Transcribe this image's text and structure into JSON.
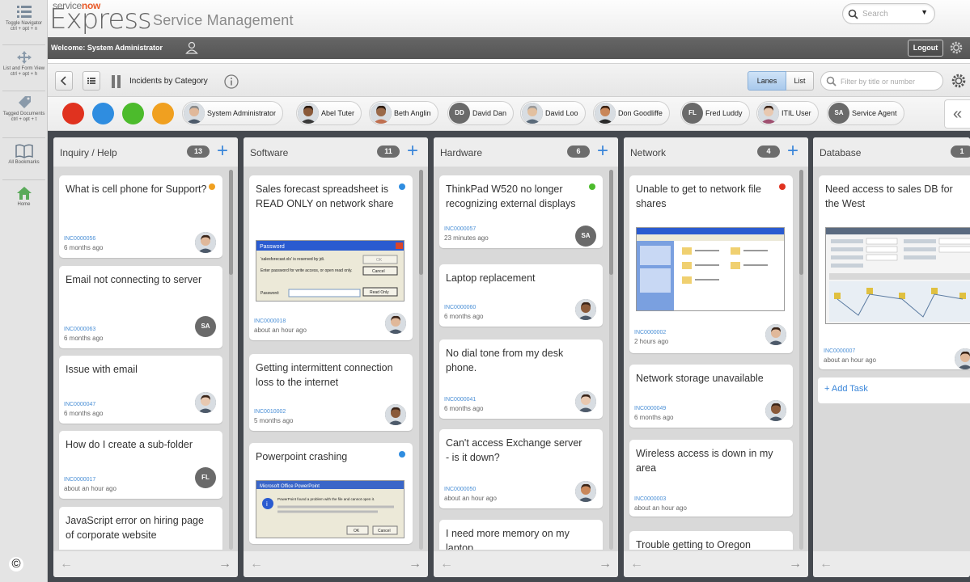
{
  "brand": {
    "top_prefix": "service",
    "top_accent": "now",
    "product": "Express",
    "subtitle": "Service Management"
  },
  "search": {
    "placeholder": "Search"
  },
  "nav": [
    {
      "label": "Toggle Navigator",
      "shortcut": "ctrl + opt + n",
      "icon": "menu-icon"
    },
    {
      "label": "List and Form View",
      "shortcut": "ctrl + opt + h",
      "icon": "arrows-icon"
    },
    {
      "label": "Tagged Documents",
      "shortcut": "ctrl + opt + t",
      "icon": "tag-icon"
    },
    {
      "label": "All Bookmarks",
      "shortcut": "",
      "icon": "book-icon"
    },
    {
      "label": "Home",
      "shortcut": "",
      "icon": "home-icon"
    }
  ],
  "user_bar": {
    "welcome": "Welcome: System Administrator",
    "logout": "Logout"
  },
  "toolbar": {
    "title": "Incidents by Category",
    "lanes": "Lanes",
    "list": "List",
    "filter_placeholder": "Filter by title or number"
  },
  "members": [
    {
      "name": "System Administrator",
      "avatar": "photo"
    },
    {
      "name": "Abel Tuter",
      "avatar": "photo"
    },
    {
      "name": "Beth Anglin",
      "avatar": "photo"
    },
    {
      "name": "David Dan",
      "avatar": "DD"
    },
    {
      "name": "David Loo",
      "avatar": "photo"
    },
    {
      "name": "Don Goodliffe",
      "avatar": "photo"
    },
    {
      "name": "Fred Luddy",
      "avatar": "FL"
    },
    {
      "name": "ITIL User",
      "avatar": "photo"
    },
    {
      "name": "Service Agent",
      "avatar": "SA"
    }
  ],
  "color_filters": [
    "#e0321f",
    "#2f8de0",
    "#4cbb2c",
    "#f0a020"
  ],
  "lanes": [
    {
      "title": "Inquiry / Help",
      "count": "13",
      "cards": [
        {
          "title": "What is cell phone for Support?",
          "number": "INC0000056",
          "age": "6 months ago",
          "dot": "#f0a020",
          "avatar": "photo"
        },
        {
          "title": "Email not connecting to server",
          "number": "INC0000063",
          "age": "6 months ago",
          "dot": "",
          "avatar": "SA"
        },
        {
          "title": "Issue with email",
          "number": "INC0000047",
          "age": "6 months ago",
          "dot": "",
          "avatar": "photo"
        },
        {
          "title": "How do I create a sub-folder",
          "number": "INC0000017",
          "age": "about an hour ago",
          "dot": "",
          "avatar": "FL"
        },
        {
          "title": "JavaScript error on hiring page of corporate website",
          "number": "",
          "age": "",
          "dot": "",
          "avatar": ""
        }
      ]
    },
    {
      "title": "Software",
      "count": "11",
      "cards": [
        {
          "title": "Sales forecast spreadsheet is READ ONLY on network share",
          "number": "INC0000018",
          "age": "about an hour ago",
          "dot": "#2f8de0",
          "avatar": "photo",
          "screenshot": {
            "title": "Password",
            "text": "'salesforecast.xls' is reserved by jdi. Enter password for write access, or open read only.",
            "field": "Password:",
            "buttons": [
              "OK",
              "Cancel",
              "Read Only"
            ]
          }
        },
        {
          "title": "Getting intermittent connection loss to the internet",
          "number": "INC0010002",
          "age": "5 months ago",
          "dot": "",
          "avatar": "photo"
        },
        {
          "title": "Powerpoint crashing",
          "number": "",
          "age": "",
          "dot": "#2f8de0",
          "avatar": "",
          "screenshot": {
            "title": "Microsoft Office PowerPoint",
            "text": "PowerPoint found a problem with the file and cannot open it.",
            "buttons": [
              "OK",
              "Cancel"
            ]
          }
        }
      ]
    },
    {
      "title": "Hardware",
      "count": "6",
      "cards": [
        {
          "title": "ThinkPad W520 no longer recognizing external displays",
          "number": "INC0000057",
          "age": "23 minutes ago",
          "dot": "#4cbb2c",
          "avatar": "SA"
        },
        {
          "title": "Laptop replacement",
          "number": "INC0000060",
          "age": "6 months ago",
          "dot": "",
          "avatar": "photo"
        },
        {
          "title": "No dial tone from my desk phone.",
          "number": "INC0000041",
          "age": "6 months ago",
          "dot": "",
          "avatar": "photo"
        },
        {
          "title": "Can't access Exchange server - is it down?",
          "number": "INC0000050",
          "age": "about an hour ago",
          "dot": "",
          "avatar": "photo"
        },
        {
          "title": "I need more memory on my laptop",
          "number": "",
          "age": "",
          "dot": "",
          "avatar": ""
        }
      ]
    },
    {
      "title": "Network",
      "count": "4",
      "cards": [
        {
          "title": "Unable to get to network file shares",
          "number": "INC0000002",
          "age": "2 hours ago",
          "dot": "#e0321f",
          "avatar": "photo"
        },
        {
          "title": "Network storage unavailable",
          "number": "INC0000049",
          "age": "6 months ago",
          "dot": "",
          "avatar": "photo"
        },
        {
          "title": "Wireless access is down in my area",
          "number": "INC0000003",
          "age": "about an hour ago",
          "dot": "",
          "avatar": ""
        },
        {
          "title": "Trouble getting to Oregon",
          "number": "",
          "age": "",
          "dot": "",
          "avatar": ""
        }
      ]
    },
    {
      "title": "Database",
      "count": "1",
      "cards": [
        {
          "title": "Need access to sales DB for the West",
          "number": "INC0000007",
          "age": "about an hour ago",
          "dot": "",
          "avatar": "photo"
        }
      ],
      "add_task": "+ Add Task"
    }
  ],
  "copyright": "©"
}
